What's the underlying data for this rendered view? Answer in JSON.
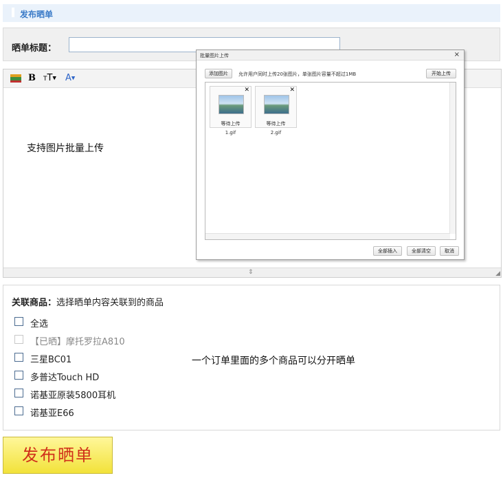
{
  "header": {
    "title": "发布晒单"
  },
  "title_row": {
    "label": "晒单标题：",
    "value": "",
    "placeholder": ""
  },
  "editor": {
    "toolbar": {
      "image_icon": "image-insert-icon",
      "bold": "B",
      "font_size": "TT",
      "font_color": "A"
    },
    "body_text": "支持图片批量上传"
  },
  "upload_dialog": {
    "title": "批量图片上传",
    "add_button": "添加图片",
    "note": "允许用户同时上传20张图片，单张图片容量不超过1MB",
    "start_button": "开始上传",
    "files": [
      {
        "status": "等待上传",
        "name": "1.gif"
      },
      {
        "status": "等待上传",
        "name": "2.gif"
      }
    ],
    "insert_all": "全部插入",
    "clear_all": "全部清空",
    "cancel": "取消"
  },
  "goods": {
    "label": "关联商品：",
    "hint": "选择晒单内容关联到的商品",
    "items": [
      {
        "label": "全选",
        "disabled": false
      },
      {
        "label": "【已晒】摩托罗拉A810",
        "disabled": true
      },
      {
        "label": "三星BC01",
        "disabled": false
      },
      {
        "label": "多普达Touch HD",
        "disabled": false
      },
      {
        "label": "诺基亚原装5800耳机",
        "disabled": false
      },
      {
        "label": "诺基亚E66",
        "disabled": false
      }
    ],
    "note": "一个订单里面的多个商品可以分开晒单"
  },
  "publish_button": "发布晒单",
  "colors": {
    "header_bg": "#eaf2fb",
    "header_text": "#3b7bc8",
    "publish_bg": "#f2e23a",
    "publish_text": "#d0301a"
  }
}
